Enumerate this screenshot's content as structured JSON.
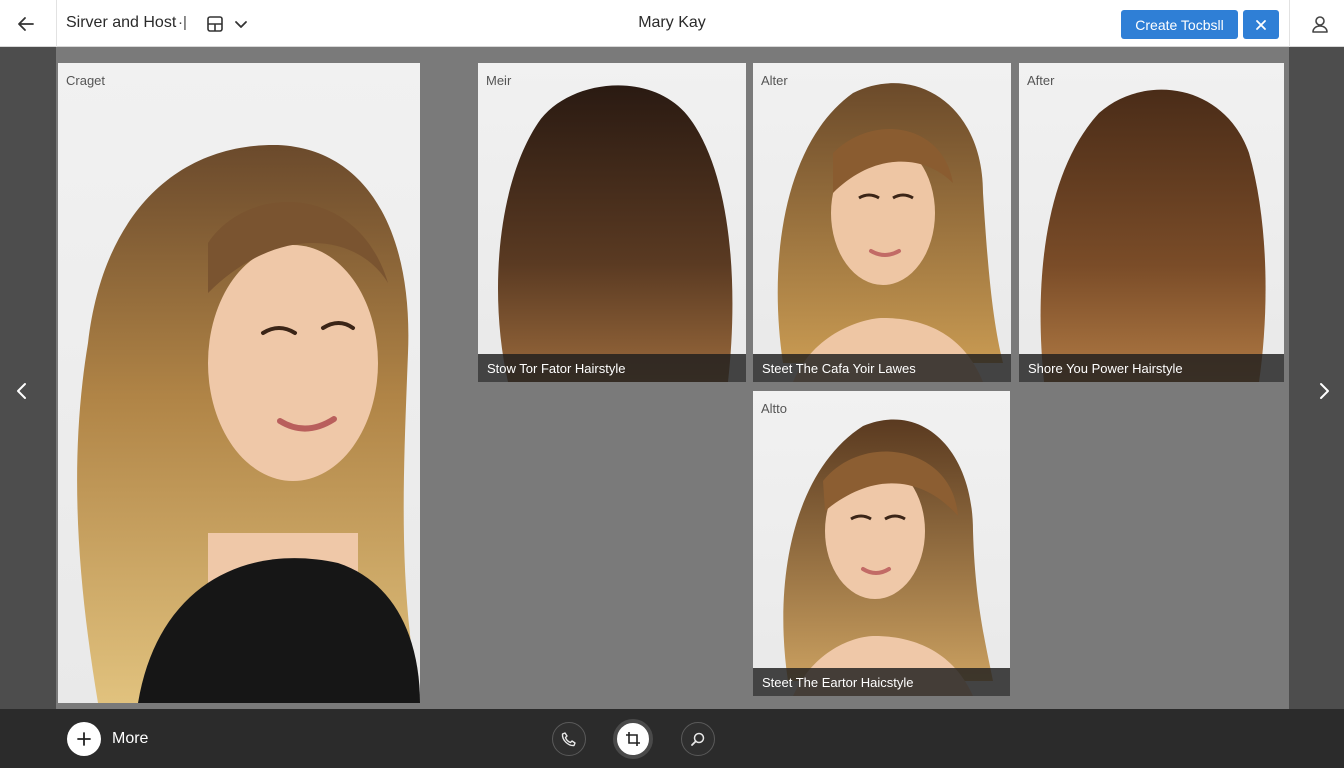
{
  "header": {
    "left_title": "Sirver and Host",
    "pin_glyph": "·|",
    "center_title": "Mary Kay",
    "create_button": "Create Tocbsll",
    "icons": [
      "back-arrow-icon",
      "layout-icon",
      "chevron-down-icon",
      "close-icon",
      "user-icon"
    ]
  },
  "main_card": {
    "tag": "Craget"
  },
  "gallery": [
    {
      "tag": "Meir",
      "caption": "Stow Tor Fator Hairstyle"
    },
    {
      "tag": "Alter",
      "caption": "Steet The Cafa Yoir Lawes"
    },
    {
      "tag": "After",
      "caption": "Shore You Power Hairstyle"
    },
    {
      "tag": "Altto",
      "caption": "Steet The Eartor Haicstyle"
    }
  ],
  "footer": {
    "more_label": "More",
    "tools": [
      "phone-icon",
      "crop-icon",
      "zoom-icon"
    ],
    "active_tool": "crop-icon"
  },
  "colors": {
    "accent": "#2f7fd6",
    "topbar": "#ffffff",
    "canvas": "#7a7a7a",
    "gutter": "#4d4d4d",
    "bottombar": "#2b2b2b"
  }
}
